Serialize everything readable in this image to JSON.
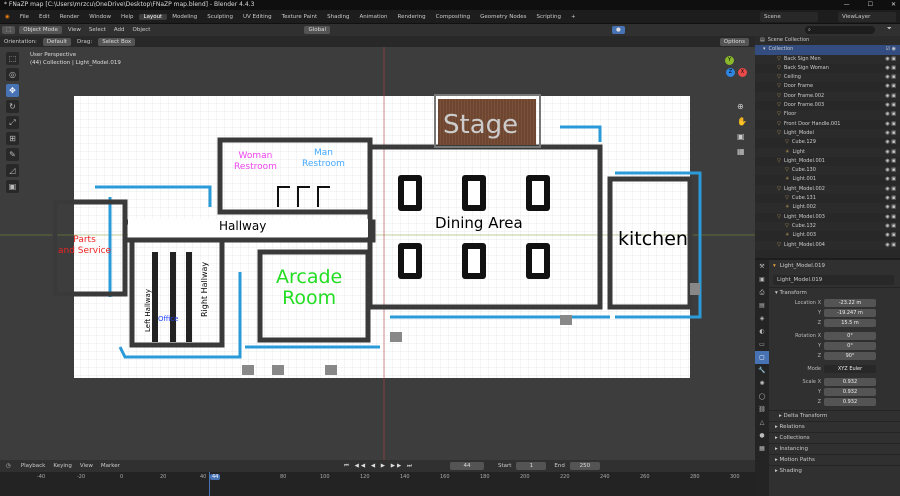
{
  "window": {
    "title": "* FNaZP map [C:\\Users\\mrzcu\\OneDrive\\Desktop\\FNaZP map.blend] - Blender 4.4.3",
    "controls": [
      "—",
      "☐",
      "✕"
    ]
  },
  "topbar": {
    "menus": [
      "File",
      "Edit",
      "Render",
      "Window",
      "Help"
    ],
    "workspaces": [
      "Layout",
      "Modeling",
      "Sculpting",
      "UV Editing",
      "Texture Paint",
      "Shading",
      "Animation",
      "Rendering",
      "Compositing",
      "Geometry Nodes",
      "Scripting"
    ],
    "active_workspace": "Layout",
    "add_tab": "+",
    "scene": "Scene",
    "view_layer": "ViewLayer"
  },
  "viewport_header": {
    "mode": "Object Mode",
    "menus": [
      "View",
      "Select",
      "Add",
      "Object"
    ],
    "transform": "Global",
    "orientation_label": "Orientation:",
    "orientation": "Default",
    "drag_label": "Drag:",
    "drag": "Select Box",
    "options": "Options"
  },
  "viewport": {
    "perspective": "User Perspective",
    "collection": "(44) Collection | Light_Model.019",
    "axes": [
      "X",
      "Y",
      "Z"
    ],
    "labels": {
      "stage": "Stage",
      "dining": "Dining Area",
      "kitchen": "kitchen",
      "hallway": "Hallway",
      "arcade": "Arcade\nRoom",
      "parts": "Parts\nand Service",
      "woman": "Woman\nRestroom",
      "man": "Man\nRestroom",
      "right_hallway": "Right Hallway",
      "left_hallway": "Left Hallway",
      "office": "Office"
    },
    "colors": {
      "stage": "#000000",
      "dining": "#000000",
      "kitchen": "#000000",
      "hallway": "#000000",
      "arcade": "#22dd22",
      "parts": "#ee2222",
      "woman": "#ee44ee",
      "man": "#44aaff",
      "office": "#2244ff"
    }
  },
  "outliner": {
    "search_placeholder": "",
    "root": "Scene Collection",
    "collection": "Collection",
    "items": [
      "Back Sign Men",
      "Back Sign Woman",
      "Ceiling",
      "Door Frame",
      "Door Frame.002",
      "Door Frame.003",
      "Floor",
      "Front Door Handle.001",
      "Light_Model",
      "Cube.129",
      "Light",
      "Light_Model.001",
      "Cube.130",
      "Light.001",
      "Light_Model.002",
      "Cube.131",
      "Light.002",
      "Light_Model.003",
      "Cube.132",
      "Light.003",
      "Light_Model.004"
    ]
  },
  "properties": {
    "object_name": "Light_Model.019",
    "data_name": "Light_Model.019",
    "transform_label": "Transform",
    "location_label": "Location X",
    "location": [
      "-23.22 m",
      "-19.247 m",
      "15.5 m"
    ],
    "rotation_label": "Rotation X",
    "rotation": [
      "0°",
      "0°",
      "90°"
    ],
    "mode_label": "Mode",
    "mode": "XYZ Euler",
    "scale_label": "Scale X",
    "scale": [
      "0.932",
      "0.932",
      "0.932"
    ],
    "axis_y": "Y",
    "axis_z": "Z",
    "sections": [
      "Delta Transform",
      "Relations",
      "Collections",
      "Instancing",
      "Motion Paths",
      "Shading"
    ]
  },
  "timeline": {
    "menus": [
      "Playback",
      "Keying",
      "View",
      "Marker"
    ],
    "current_frame": "44",
    "start_label": "Start",
    "start": "1",
    "end_label": "End",
    "end": "250",
    "ticks": [
      "-40",
      "-20",
      "0",
      "20",
      "40",
      "44",
      "80",
      "100",
      "120",
      "140",
      "160",
      "180",
      "200",
      "220",
      "240",
      "260",
      "280",
      "300"
    ]
  }
}
